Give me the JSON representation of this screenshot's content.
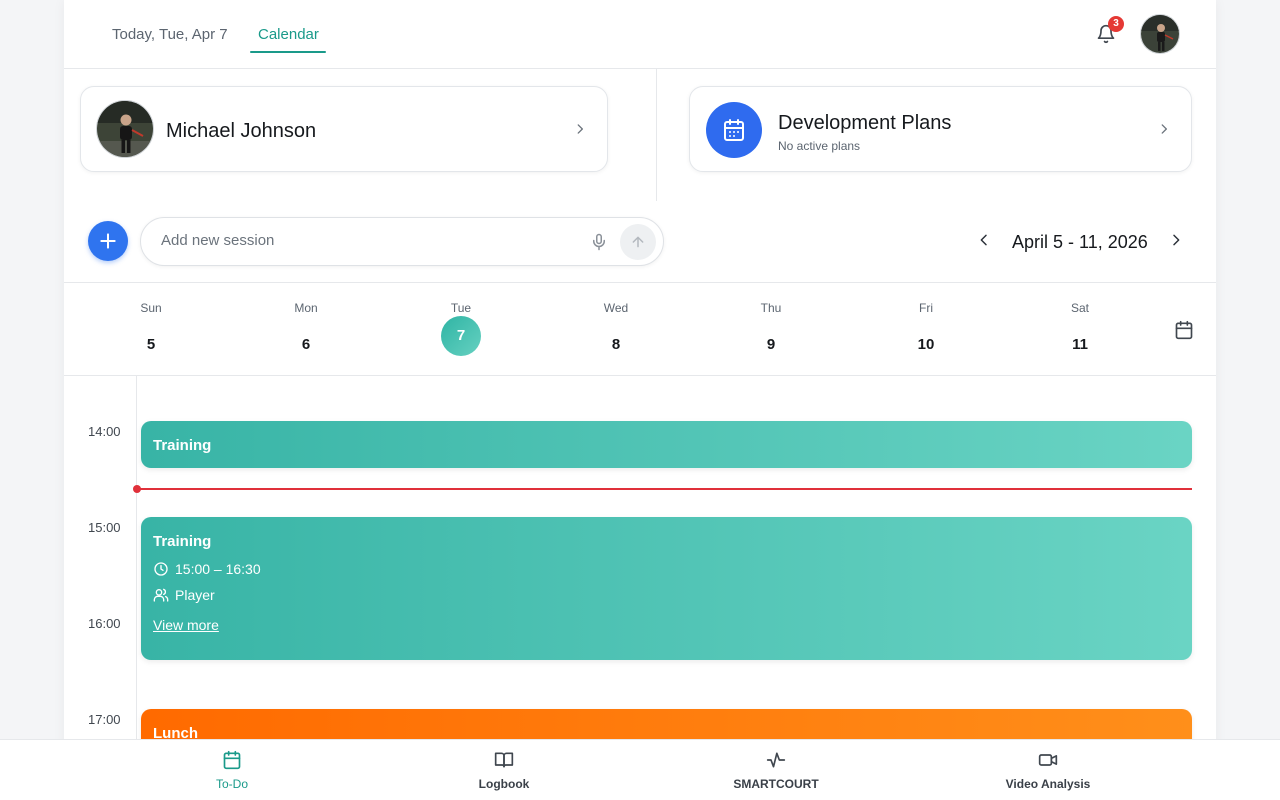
{
  "header": {
    "tabs": [
      {
        "label": "Today, Tue, Apr 7",
        "active": false
      },
      {
        "label": "Calendar",
        "active": true
      }
    ],
    "notifications_count": "3",
    "icons": {
      "bell": "bell-icon",
      "avatar": "user-avatar"
    }
  },
  "player_card": {
    "name": "Michael Johnson"
  },
  "plans_card": {
    "title": "Development Plans",
    "subtitle": "No active plans"
  },
  "session": {
    "placeholder": "Add new session"
  },
  "week": {
    "range": "April 5 - 11, 2026",
    "days": [
      {
        "name": "Sun",
        "num": "5"
      },
      {
        "name": "Mon",
        "num": "6"
      },
      {
        "name": "Tue",
        "num": "7",
        "active": true
      },
      {
        "name": "Wed",
        "num": "8"
      },
      {
        "name": "Thu",
        "num": "9"
      },
      {
        "name": "Fri",
        "num": "10"
      },
      {
        "name": "Sat",
        "num": "11"
      }
    ]
  },
  "timeline": {
    "hours": [
      "14:00",
      "15:00",
      "16:00",
      "17:00"
    ],
    "events": [
      {
        "title": "Training",
        "color": "#38b4a6"
      },
      {
        "title": "Training",
        "time": "15:00 – 16:30",
        "participants": "Player",
        "link": "View more",
        "color": "#38b4a6"
      },
      {
        "title": "Lunch",
        "color": "#ff6a00"
      }
    ]
  },
  "bottom_nav": [
    {
      "label": "To-Do",
      "icon": "calendar-icon",
      "active": true
    },
    {
      "label": "Logbook",
      "icon": "book-icon"
    },
    {
      "label": "SMARTCOURT",
      "icon": "activity-icon"
    },
    {
      "label": "Video Analysis",
      "icon": "video-icon"
    }
  ],
  "colors": {
    "accent": "#1a9a8a",
    "primary": "#2f74ef",
    "now_line": "#e0303a"
  }
}
